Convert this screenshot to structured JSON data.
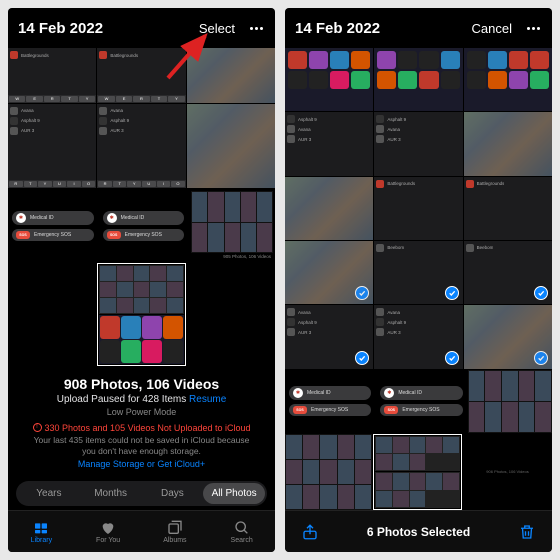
{
  "date": "14 Feb 2022",
  "left": {
    "select_label": "Select",
    "apps": {
      "battlegrounds": "Battlegrounds",
      "avana": "Avana",
      "asphalt": "Asphalt 9",
      "aur": "AUR 3"
    },
    "medical": {
      "medical_id": "Medical ID",
      "sos": "SOS",
      "emergency": "Emergency SOS"
    },
    "mini_count": "905 Photos, 106 Videos",
    "summary": {
      "title": "908 Photos, 106 Videos",
      "paused": "Upload Paused for 428 Items",
      "resume": "Resume",
      "lpm": "Low Power Mode",
      "warn": "330 Photos and 105 Videos Not Uploaded to iCloud",
      "desc1": "Your last 435 items could not be saved in iCloud because",
      "desc2": "you don't have enough storage.",
      "manage": "Manage Storage or Get iCloud+"
    },
    "segments": {
      "years": "Years",
      "months": "Months",
      "days": "Days",
      "all": "All Photos"
    },
    "tabs": {
      "library": "Library",
      "foryou": "For You",
      "albums": "Albums",
      "search": "Search"
    }
  },
  "right": {
    "cancel_label": "Cancel",
    "apps": {
      "asphalt": "Asphalt 9",
      "avana": "Avana",
      "aur": "AUR 3",
      "battlegrounds": "Battlegrounds",
      "beebom": "Beebom"
    },
    "medical": {
      "medical_id": "Medical ID",
      "sos": "SOS",
      "emergency": "Emergency SOS"
    },
    "selected_count": "6 Photos Selected"
  }
}
